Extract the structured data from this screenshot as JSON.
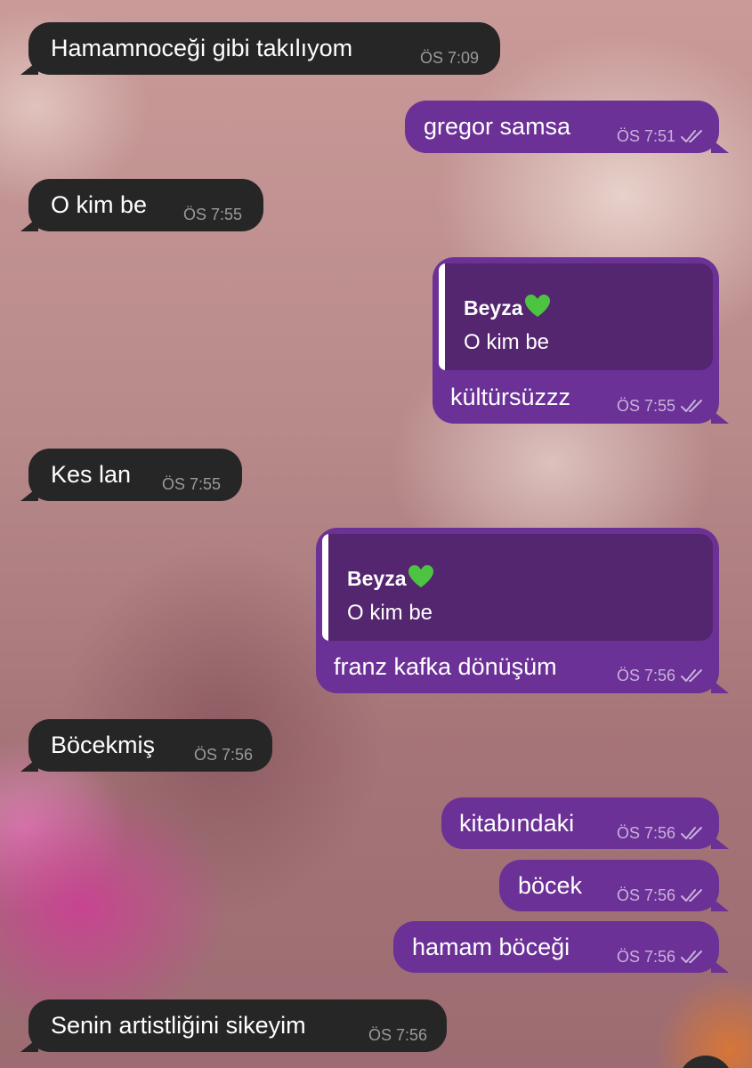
{
  "colors": {
    "incoming_bubble": "#262626",
    "outgoing_bubble": "#6b3196",
    "reply_quote_bg": "#54266f",
    "incoming_time": "#9a9a9a",
    "outgoing_time": "#c9b2dc"
  },
  "messages": [
    {
      "direction": "incoming",
      "text": "Hamamnoceği gibi takılıyom",
      "time": "ÖS 7:09"
    },
    {
      "direction": "outgoing",
      "text": "gregor samsa",
      "time": "ÖS 7:51",
      "status_icon": "double-check-icon"
    },
    {
      "direction": "incoming",
      "text": "O kim be",
      "time": "ÖS 7:55"
    },
    {
      "direction": "outgoing",
      "text": "kültürsüzzz",
      "time": "ÖS 7:55",
      "status_icon": "double-check-icon",
      "reply": {
        "sender": "Beyza",
        "sender_emoji_icon": "green-heart-icon",
        "text": "O kim be"
      }
    },
    {
      "direction": "incoming",
      "text": "Kes lan",
      "time": "ÖS 7:55"
    },
    {
      "direction": "outgoing",
      "text": "franz kafka dönüşüm",
      "time": "ÖS 7:56",
      "status_icon": "double-check-icon",
      "reply": {
        "sender": "Beyza",
        "sender_emoji_icon": "green-heart-icon",
        "text": "O kim be"
      }
    },
    {
      "direction": "incoming",
      "text": "Böcekmiş",
      "time": "ÖS 7:56"
    },
    {
      "direction": "outgoing",
      "text": "kitabındaki",
      "time": "ÖS 7:56",
      "status_icon": "double-check-icon"
    },
    {
      "direction": "outgoing",
      "text": "böcek",
      "time": "ÖS 7:56",
      "status_icon": "double-check-icon"
    },
    {
      "direction": "outgoing",
      "text": "hamam böceği",
      "time": "ÖS 7:56",
      "status_icon": "double-check-icon"
    },
    {
      "direction": "incoming",
      "text": "Senin artistliğini sikeyim",
      "time": "ÖS 7:56"
    }
  ]
}
